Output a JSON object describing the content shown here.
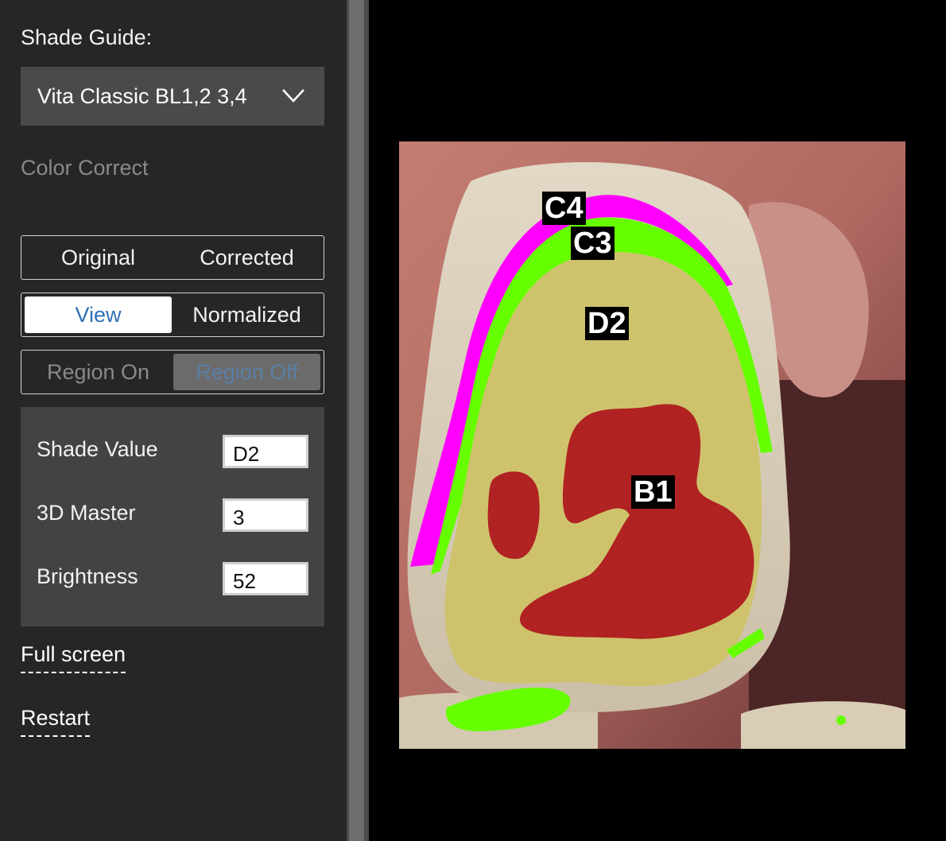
{
  "sidebar": {
    "shade_guide_label": "Shade Guide:",
    "shade_guide_value": "Vita Classic BL1,2 3,4",
    "color_correct_label": "Color Correct",
    "toggle_original": "Original",
    "toggle_corrected": "Corrected",
    "toggle_view": "View",
    "toggle_normalized": "Normalized",
    "toggle_region_on": "Region On",
    "toggle_region_off": "Region Off",
    "fields": {
      "shade_value_label": "Shade Value",
      "shade_value": "D2",
      "master_3d_label": "3D Master",
      "master_3d": "3",
      "brightness_label": "Brightness",
      "brightness": "52"
    },
    "full_screen_link": "Full screen",
    "restart_link": "Restart"
  },
  "image": {
    "regions": [
      "C4",
      "C3",
      "D2",
      "B1"
    ],
    "region_colors": {
      "C4": "#ff00ff",
      "C3": "#66ff00",
      "D2": "#cec36c",
      "B1": "#b12222"
    }
  },
  "colors": {
    "sidebar_bg": "#262626",
    "dropdown_bg": "#4a4a4a",
    "panel_bg": "#434343",
    "selected_toggle_bg": "#ffffff",
    "selected_toggle_text": "#2f6fb5",
    "region_off_bg": "#6b6b6b",
    "region_off_text": "#5b7fa6"
  }
}
